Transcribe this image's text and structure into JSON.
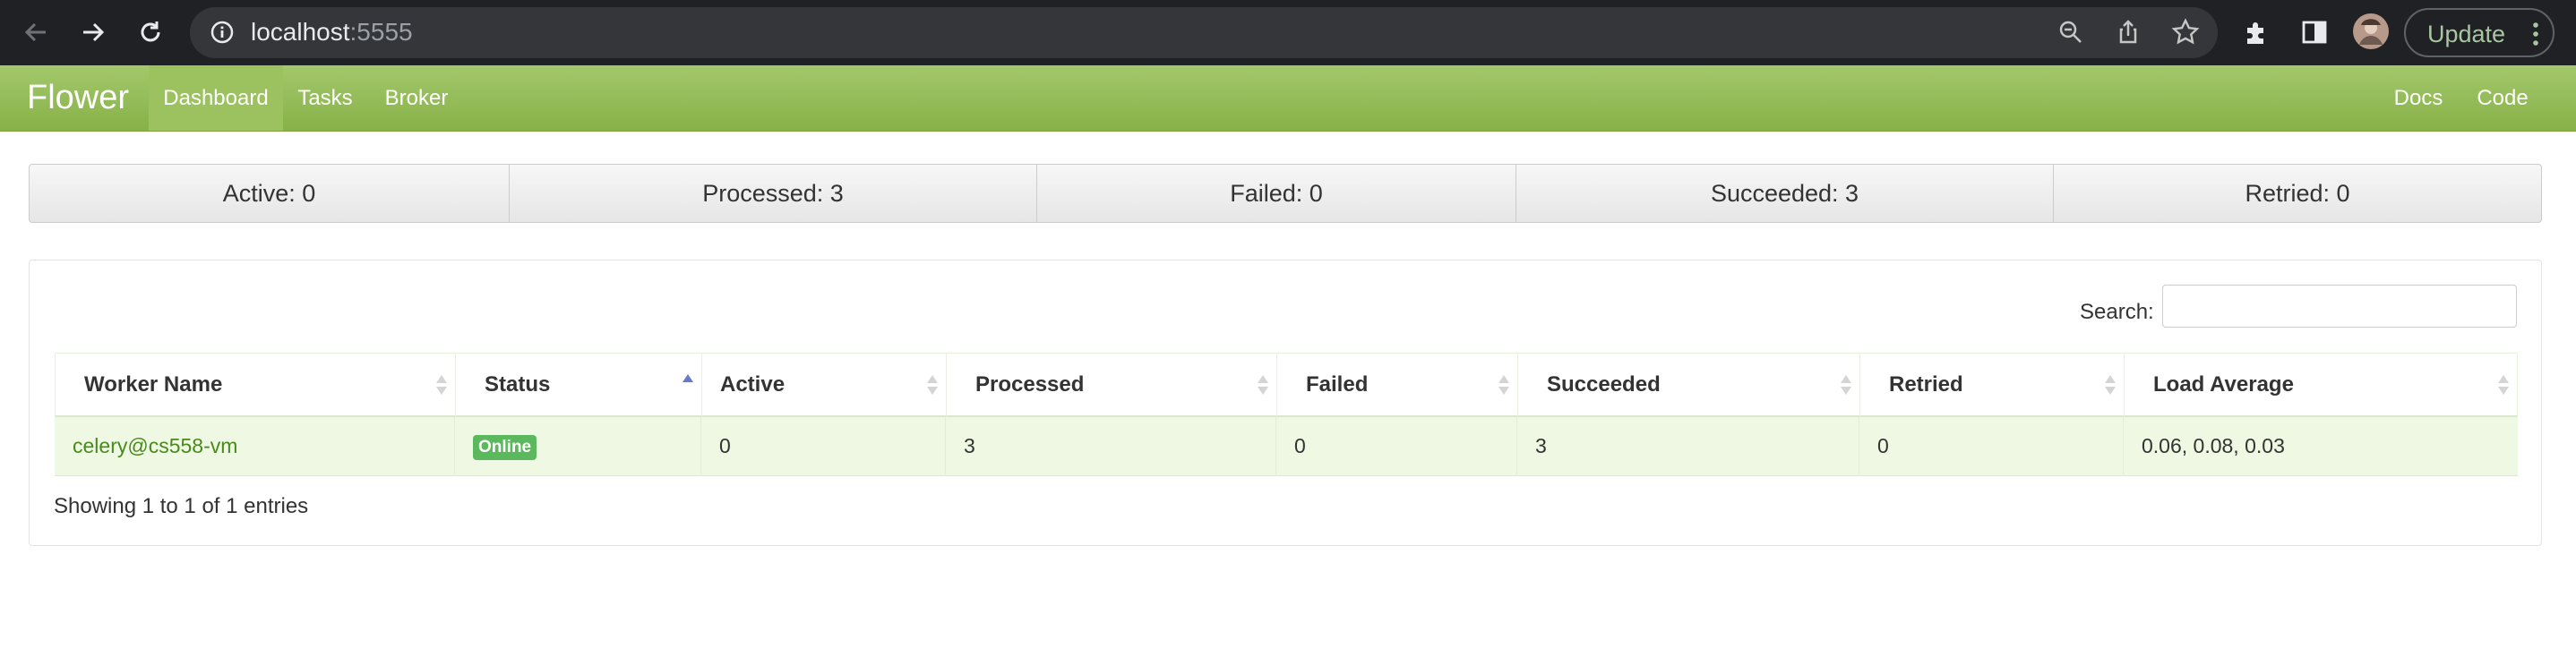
{
  "browser": {
    "url_host": "localhost",
    "url_port": ":5555",
    "update_label": "Update"
  },
  "navbar": {
    "brand": "Flower",
    "items": [
      {
        "label": "Dashboard",
        "active": true
      },
      {
        "label": "Tasks"
      },
      {
        "label": "Broker"
      }
    ],
    "right_items": [
      {
        "label": "Docs"
      },
      {
        "label": "Code"
      }
    ]
  },
  "summary": [
    {
      "label": "Active: 0"
    },
    {
      "label": "Processed: 3"
    },
    {
      "label": "Failed: 0"
    },
    {
      "label": "Succeeded: 3"
    },
    {
      "label": "Retried: 0"
    }
  ],
  "workers": {
    "search_label": "Search:",
    "search_value": "",
    "columns": [
      "Worker Name",
      "Status",
      "Active",
      "Processed",
      "Failed",
      "Succeeded",
      "Retried",
      "Load Average"
    ],
    "sorted_column": "Status",
    "sort_direction": "ascending",
    "rows": [
      {
        "worker_name": "celery@cs558-vm",
        "status": "Online",
        "active": "0",
        "processed": "3",
        "failed": "0",
        "succeeded": "3",
        "retried": "0",
        "load_average": "0.06, 0.08, 0.03"
      }
    ],
    "info": "Showing 1 to 1 of 1 entries"
  },
  "colors": {
    "navbar_top": "#a3c86b",
    "navbar_bottom": "#87b148",
    "link_green": "#4a8a1c",
    "online_badge": "#5cb85c",
    "row_highlight": "#eef8e2"
  }
}
